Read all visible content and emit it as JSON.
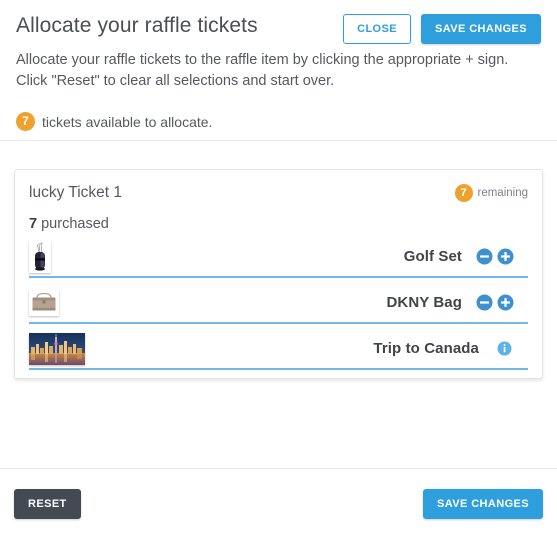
{
  "header": {
    "title": "Allocate your raffle tickets",
    "description": "Allocate your raffle tickets to the raffle item by clicking the appropriate + sign. Click \"Reset\" to clear all selections and start over.",
    "close_label": "CLOSE",
    "save_label": "SAVE CHANGES",
    "available_count": "7",
    "available_text": "tickets available to allocate."
  },
  "card": {
    "ticket_name": "lucky Ticket 1",
    "remaining_count": "7",
    "remaining_label": "remaining",
    "purchased_qty": "7",
    "purchased_label": "purchased",
    "items": [
      {
        "label": "Golf Set",
        "thumb": "golf-bag-thumbnail",
        "minus_icon": "minus-circle-icon",
        "plus_icon": "plus-circle-icon"
      },
      {
        "label": "DKNY Bag",
        "thumb": "handbag-thumbnail",
        "minus_icon": "minus-circle-icon",
        "plus_icon": "plus-circle-icon"
      },
      {
        "label": "Trip to Canada",
        "thumb": "toronto-skyline-thumbnail",
        "info_icon": "info-circle-icon"
      }
    ]
  },
  "footer": {
    "reset_label": "RESET",
    "save_label": "SAVE CHANGES"
  },
  "colors": {
    "primary_blue": "#2e9fdc",
    "row_underline": "#6fb9e8",
    "badge_orange": "#efa12e",
    "dark_button": "#434a54",
    "info_blue": "#5bb4e5"
  }
}
